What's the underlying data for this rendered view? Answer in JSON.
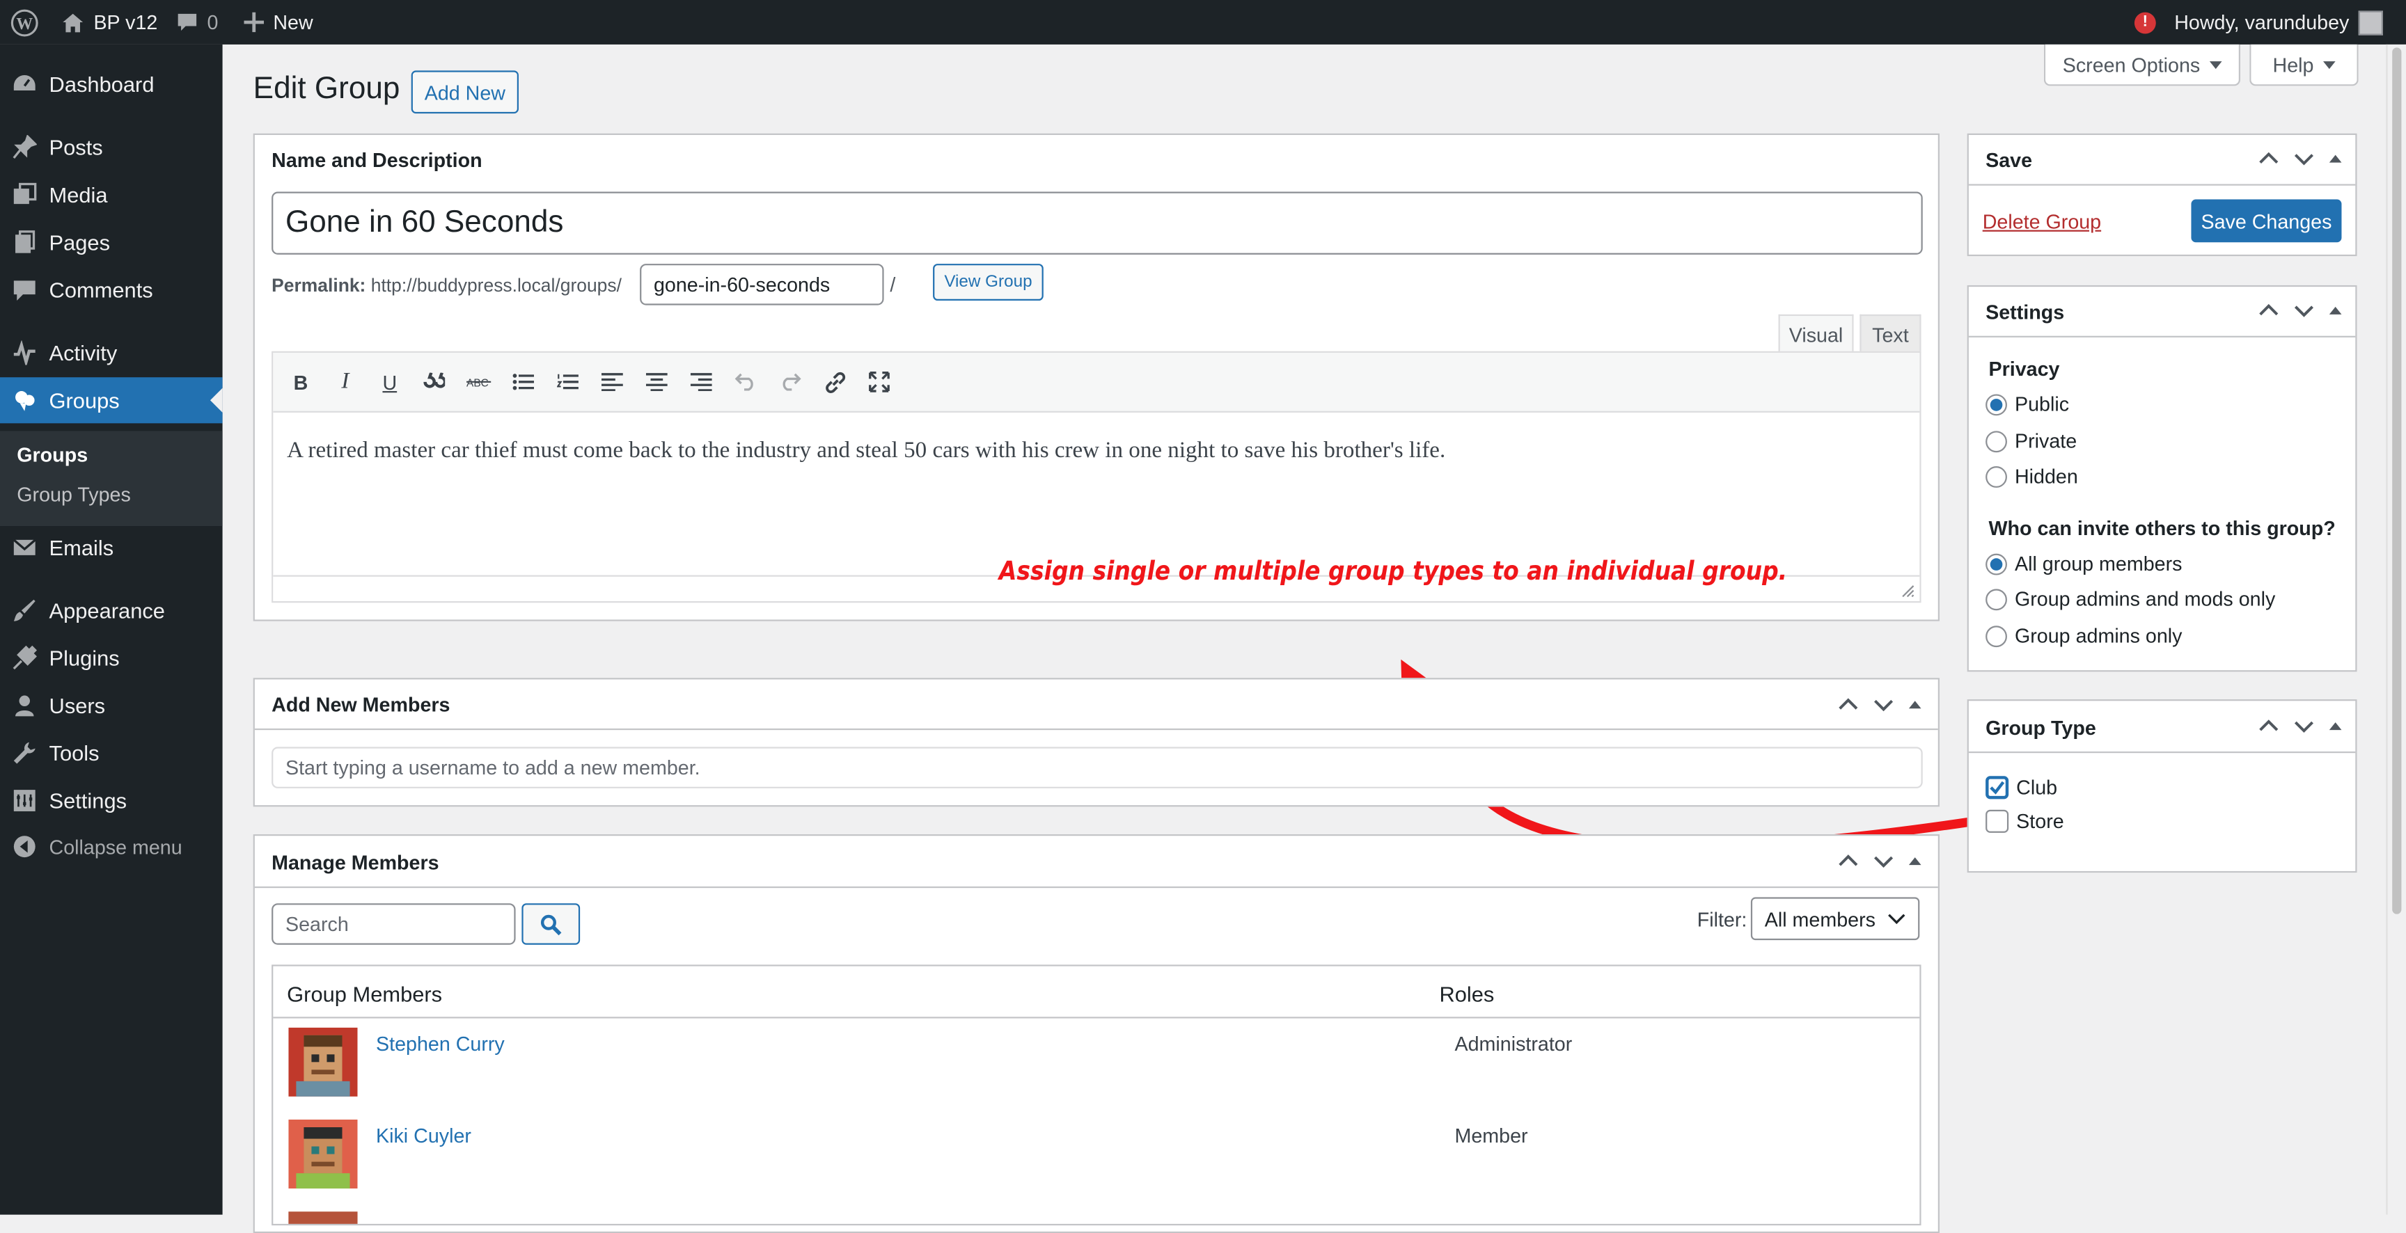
{
  "admin_bar": {
    "site_name": "BP v12",
    "comments_count": "0",
    "new_label": "New",
    "howdy": "Howdy, varundubey",
    "notification_badge": "!"
  },
  "sidebar": {
    "items": [
      {
        "label": "Dashboard",
        "icon": "dashboard-icon"
      },
      {
        "label": "Posts",
        "icon": "pin-icon"
      },
      {
        "label": "Media",
        "icon": "media-icon"
      },
      {
        "label": "Pages",
        "icon": "pages-icon"
      },
      {
        "label": "Comments",
        "icon": "comment-icon"
      },
      {
        "label": "Activity",
        "icon": "activity-icon"
      },
      {
        "label": "Groups",
        "icon": "groups-icon"
      },
      {
        "label": "Emails",
        "icon": "email-icon"
      },
      {
        "label": "Appearance",
        "icon": "brush-icon"
      },
      {
        "label": "Plugins",
        "icon": "plug-icon"
      },
      {
        "label": "Users",
        "icon": "user-icon"
      },
      {
        "label": "Tools",
        "icon": "wrench-icon"
      },
      {
        "label": "Settings",
        "icon": "settings-icon"
      }
    ],
    "submenu": [
      "Groups",
      "Group Types"
    ],
    "collapse_label": "Collapse menu"
  },
  "header": {
    "title": "Edit Group",
    "add_new": "Add New",
    "screen_options": "Screen Options",
    "help": "Help"
  },
  "name_box": {
    "title": "Name and Description",
    "group_name": "Gone in 60 Seconds",
    "permalink_label": "Permalink:",
    "permalink_base": "http://buddypress.local/groups/",
    "slug": "gone-in-60-seconds",
    "slug_suffix": "/",
    "view_group": "View Group",
    "tab_visual": "Visual",
    "tab_text": "Text",
    "toolbar_format": [
      "B",
      "I",
      "U"
    ],
    "description": "A retired master car thief must come back to the industry and steal 50 cars with his crew in one night to save his brother's life."
  },
  "annotation": {
    "text": "Assign single or multiple group types to an individual group.",
    "color": "#f0161a"
  },
  "add_members": {
    "title": "Add New Members",
    "placeholder": "Start typing a username to add a new member."
  },
  "manage_members": {
    "title": "Manage Members",
    "search_placeholder": "Search",
    "filter_label": "Filter:",
    "filter_value": "All members",
    "col_members": "Group Members",
    "col_roles": "Roles",
    "members": [
      {
        "name": "Stephen Curry",
        "role": "Administrator"
      },
      {
        "name": "Kiki Cuyler",
        "role": "Member"
      }
    ]
  },
  "save_box": {
    "title": "Save",
    "delete": "Delete Group",
    "save": "Save Changes"
  },
  "settings_box": {
    "title": "Settings",
    "privacy_label": "Privacy",
    "privacy_options": [
      "Public",
      "Private",
      "Hidden"
    ],
    "privacy_selected": "Public",
    "invite_label": "Who can invite others to this group?",
    "invite_options": [
      "All group members",
      "Group admins and mods only",
      "Group admins only"
    ],
    "invite_selected": "All group members"
  },
  "group_type_box": {
    "title": "Group Type",
    "types": [
      {
        "label": "Club",
        "checked": true
      },
      {
        "label": "Store",
        "checked": false
      }
    ]
  },
  "colors": {
    "accent": "#2271b1",
    "admin_bar": "#1d2327",
    "delete": "#b32d2e"
  }
}
